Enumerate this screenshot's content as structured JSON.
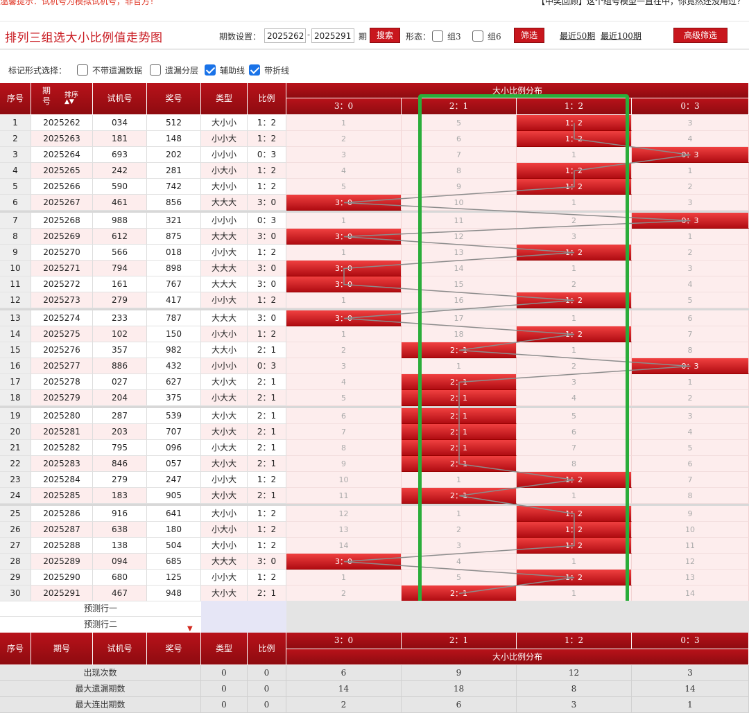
{
  "notice": {
    "left": "温馨提示：试机号为模拟试机号，非官方！",
    "right": "【中奖回顾】这个组号模型一直在中，你竟然还没用过？"
  },
  "header": {
    "title": "排列三组选大小比例值走势图",
    "period_label": "期数设置：",
    "period_from": "2025262",
    "period_to": "2025291",
    "period_suffix": "期",
    "search_label": "搜索",
    "shape_label": "形态：",
    "g3_label": "组3",
    "g6_label": "组6",
    "filter_label": "筛选",
    "recent50": "最近50期",
    "recent100": "最近100期",
    "advanced_label": "高级筛选"
  },
  "marks": {
    "label": "标记形式选择：",
    "opt1": "不带遗漏数据",
    "opt2": "遗漏分层",
    "opt3": "辅助线",
    "opt4": "带折线"
  },
  "columns": {
    "seq": "序号",
    "period": "期号",
    "sort": "排序",
    "trial": "试机号",
    "winning": "奖号",
    "type": "类型",
    "ratio": "比例",
    "dist_title": "大小比例分布",
    "d30": "3：0",
    "d21": "2：1",
    "d12": "1：2",
    "d03": "0：3"
  },
  "rows": [
    {
      "seq": "1",
      "period": "2025262",
      "trial": "034",
      "win": "512",
      "type": "大小小",
      "ratio": "1：2",
      "d": [
        "1",
        "5",
        "1：2",
        "3"
      ],
      "hit": 2
    },
    {
      "seq": "2",
      "period": "2025263",
      "trial": "181",
      "win": "148",
      "type": "小小大",
      "ratio": "1：2",
      "d": [
        "2",
        "6",
        "1：2",
        "4"
      ],
      "hit": 2
    },
    {
      "seq": "3",
      "period": "2025264",
      "trial": "693",
      "win": "202",
      "type": "小小小",
      "ratio": "0：3",
      "d": [
        "3",
        "7",
        "1",
        "0：3"
      ],
      "hit": 3
    },
    {
      "seq": "4",
      "period": "2025265",
      "trial": "242",
      "win": "281",
      "type": "小大小",
      "ratio": "1：2",
      "d": [
        "4",
        "8",
        "1：2",
        "1"
      ],
      "hit": 2
    },
    {
      "seq": "5",
      "period": "2025266",
      "trial": "590",
      "win": "742",
      "type": "大小小",
      "ratio": "1：2",
      "d": [
        "5",
        "9",
        "1：2",
        "2"
      ],
      "hit": 2
    },
    {
      "seq": "6",
      "period": "2025267",
      "trial": "461",
      "win": "856",
      "type": "大大大",
      "ratio": "3：0",
      "d": [
        "3：0",
        "10",
        "1",
        "3"
      ],
      "hit": 0
    },
    {
      "seq": "7",
      "period": "2025268",
      "trial": "988",
      "win": "321",
      "type": "小小小",
      "ratio": "0：3",
      "d": [
        "1",
        "11",
        "2",
        "0：3"
      ],
      "hit": 3
    },
    {
      "seq": "8",
      "period": "2025269",
      "trial": "612",
      "win": "875",
      "type": "大大大",
      "ratio": "3：0",
      "d": [
        "3：0",
        "12",
        "3",
        "1"
      ],
      "hit": 0
    },
    {
      "seq": "9",
      "period": "2025270",
      "trial": "566",
      "win": "018",
      "type": "小小大",
      "ratio": "1：2",
      "d": [
        "1",
        "13",
        "1：2",
        "2"
      ],
      "hit": 2
    },
    {
      "seq": "10",
      "period": "2025271",
      "trial": "794",
      "win": "898",
      "type": "大大大",
      "ratio": "3：0",
      "d": [
        "3：0",
        "14",
        "1",
        "3"
      ],
      "hit": 0
    },
    {
      "seq": "11",
      "period": "2025272",
      "trial": "161",
      "win": "767",
      "type": "大大大",
      "ratio": "3：0",
      "d": [
        "3：0",
        "15",
        "2",
        "4"
      ],
      "hit": 0
    },
    {
      "seq": "12",
      "period": "2025273",
      "trial": "279",
      "win": "417",
      "type": "小小大",
      "ratio": "1：2",
      "d": [
        "1",
        "16",
        "1：2",
        "5"
      ],
      "hit": 2
    },
    {
      "seq": "13",
      "period": "2025274",
      "trial": "233",
      "win": "787",
      "type": "大大大",
      "ratio": "3：0",
      "d": [
        "3：0",
        "17",
        "1",
        "6"
      ],
      "hit": 0
    },
    {
      "seq": "14",
      "period": "2025275",
      "trial": "102",
      "win": "150",
      "type": "小大小",
      "ratio": "1：2",
      "d": [
        "1",
        "18",
        "1：2",
        "7"
      ],
      "hit": 2
    },
    {
      "seq": "15",
      "period": "2025276",
      "trial": "357",
      "win": "982",
      "type": "大大小",
      "ratio": "2：1",
      "d": [
        "2",
        "2：1",
        "1",
        "8"
      ],
      "hit": 1
    },
    {
      "seq": "16",
      "period": "2025277",
      "trial": "886",
      "win": "432",
      "type": "小小小",
      "ratio": "0：3",
      "d": [
        "3",
        "1",
        "2",
        "0：3"
      ],
      "hit": 3
    },
    {
      "seq": "17",
      "period": "2025278",
      "trial": "027",
      "win": "627",
      "type": "大小大",
      "ratio": "2：1",
      "d": [
        "4",
        "2：1",
        "3",
        "1"
      ],
      "hit": 1
    },
    {
      "seq": "18",
      "period": "2025279",
      "trial": "204",
      "win": "375",
      "type": "小大大",
      "ratio": "2：1",
      "d": [
        "5",
        "2：1",
        "4",
        "2"
      ],
      "hit": 1
    },
    {
      "seq": "19",
      "period": "2025280",
      "trial": "287",
      "win": "539",
      "type": "大小大",
      "ratio": "2：1",
      "d": [
        "6",
        "2：1",
        "5",
        "3"
      ],
      "hit": 1
    },
    {
      "seq": "20",
      "period": "2025281",
      "trial": "203",
      "win": "707",
      "type": "大小大",
      "ratio": "2：1",
      "d": [
        "7",
        "2：1",
        "6",
        "4"
      ],
      "hit": 1
    },
    {
      "seq": "21",
      "period": "2025282",
      "trial": "795",
      "win": "096",
      "type": "小大大",
      "ratio": "2：1",
      "d": [
        "8",
        "2：1",
        "7",
        "5"
      ],
      "hit": 1
    },
    {
      "seq": "22",
      "period": "2025283",
      "trial": "846",
      "win": "057",
      "type": "大小大",
      "ratio": "2：1",
      "d": [
        "9",
        "2：1",
        "8",
        "6"
      ],
      "hit": 1
    },
    {
      "seq": "23",
      "period": "2025284",
      "trial": "279",
      "win": "247",
      "type": "小小大",
      "ratio": "1：2",
      "d": [
        "10",
        "1",
        "1：2",
        "7"
      ],
      "hit": 2
    },
    {
      "seq": "24",
      "period": "2025285",
      "trial": "183",
      "win": "905",
      "type": "大小大",
      "ratio": "2：1",
      "d": [
        "11",
        "2：1",
        "1",
        "8"
      ],
      "hit": 1
    },
    {
      "seq": "25",
      "period": "2025286",
      "trial": "916",
      "win": "641",
      "type": "大小小",
      "ratio": "1：2",
      "d": [
        "12",
        "1",
        "1：2",
        "9"
      ],
      "hit": 2
    },
    {
      "seq": "26",
      "period": "2025287",
      "trial": "638",
      "win": "180",
      "type": "小大小",
      "ratio": "1：2",
      "d": [
        "13",
        "2",
        "1：2",
        "10"
      ],
      "hit": 2
    },
    {
      "seq": "27",
      "period": "2025288",
      "trial": "138",
      "win": "504",
      "type": "大小小",
      "ratio": "1：2",
      "d": [
        "14",
        "3",
        "1：2",
        "11"
      ],
      "hit": 2
    },
    {
      "seq": "28",
      "period": "2025289",
      "trial": "094",
      "win": "685",
      "type": "大大大",
      "ratio": "3：0",
      "d": [
        "3：0",
        "4",
        "1",
        "12"
      ],
      "hit": 0
    },
    {
      "seq": "29",
      "period": "2025290",
      "trial": "680",
      "win": "125",
      "type": "小小大",
      "ratio": "1：2",
      "d": [
        "1",
        "5",
        "1：2",
        "13"
      ],
      "hit": 2
    },
    {
      "seq": "30",
      "period": "2025291",
      "trial": "467",
      "win": "948",
      "type": "大小大",
      "ratio": "2：1",
      "d": [
        "2",
        "2：1",
        "1",
        "14"
      ],
      "hit": 1
    }
  ],
  "predict": {
    "row1": "预测行一",
    "row2": "预测行二"
  },
  "footer": {
    "appear": {
      "label": "出现次数",
      "type": "0",
      "ratio": "0",
      "vals": [
        "6",
        "9",
        "12",
        "3"
      ]
    },
    "maxmiss": {
      "label": "最大遗漏期数",
      "type": "0",
      "ratio": "0",
      "vals": [
        "14",
        "18",
        "8",
        "14"
      ]
    },
    "maxcont": {
      "label": "最大连出期数",
      "type": "0",
      "ratio": "0",
      "vals": [
        "2",
        "6",
        "3",
        "1"
      ]
    }
  },
  "colors": {
    "brand": "#c8161d",
    "highlight": "#2aad3a",
    "checkbox": "#1a73e8"
  }
}
